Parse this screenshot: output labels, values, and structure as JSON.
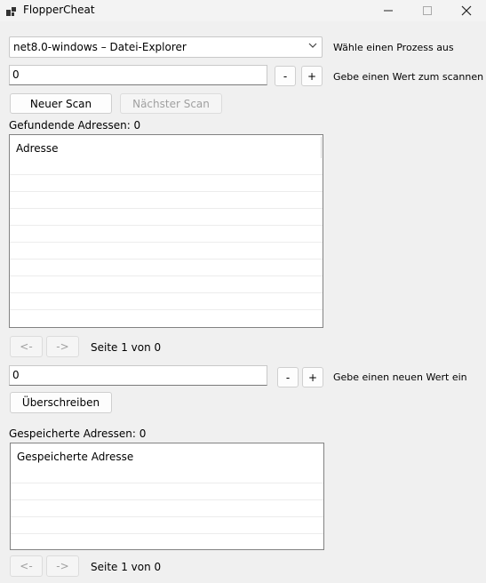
{
  "window": {
    "title": "FlopperCheat",
    "icons": [
      "app-icon",
      "minimize-icon",
      "maximize-icon",
      "close-icon"
    ]
  },
  "process": {
    "selected": "net8.0-windows – Datei-Explorer",
    "label": "Wähle einen Prozess aus"
  },
  "scan": {
    "value": "0",
    "minus_label": "-",
    "plus_label": "+",
    "hint": "Gebe einen Wert zum scannen ein",
    "new_scan_label": "Neuer Scan",
    "next_scan_label": "Nächster Scan"
  },
  "found": {
    "label": "Gefundende Adressen: 0",
    "column_header": "Adresse",
    "prev_label": "<-",
    "next_label": "->",
    "page_label": "Seite 1 von 0"
  },
  "overwrite": {
    "value": "0",
    "minus_label": "-",
    "plus_label": "+",
    "hint": "Gebe einen neuen Wert ein",
    "button_label": "Überschreiben"
  },
  "saved": {
    "label": "Gespeicherte Adressen: 0",
    "column_header": "Gespeicherte Adresse",
    "prev_label": "<-",
    "next_label": "->",
    "page_label": "Seite 1 von 0"
  }
}
